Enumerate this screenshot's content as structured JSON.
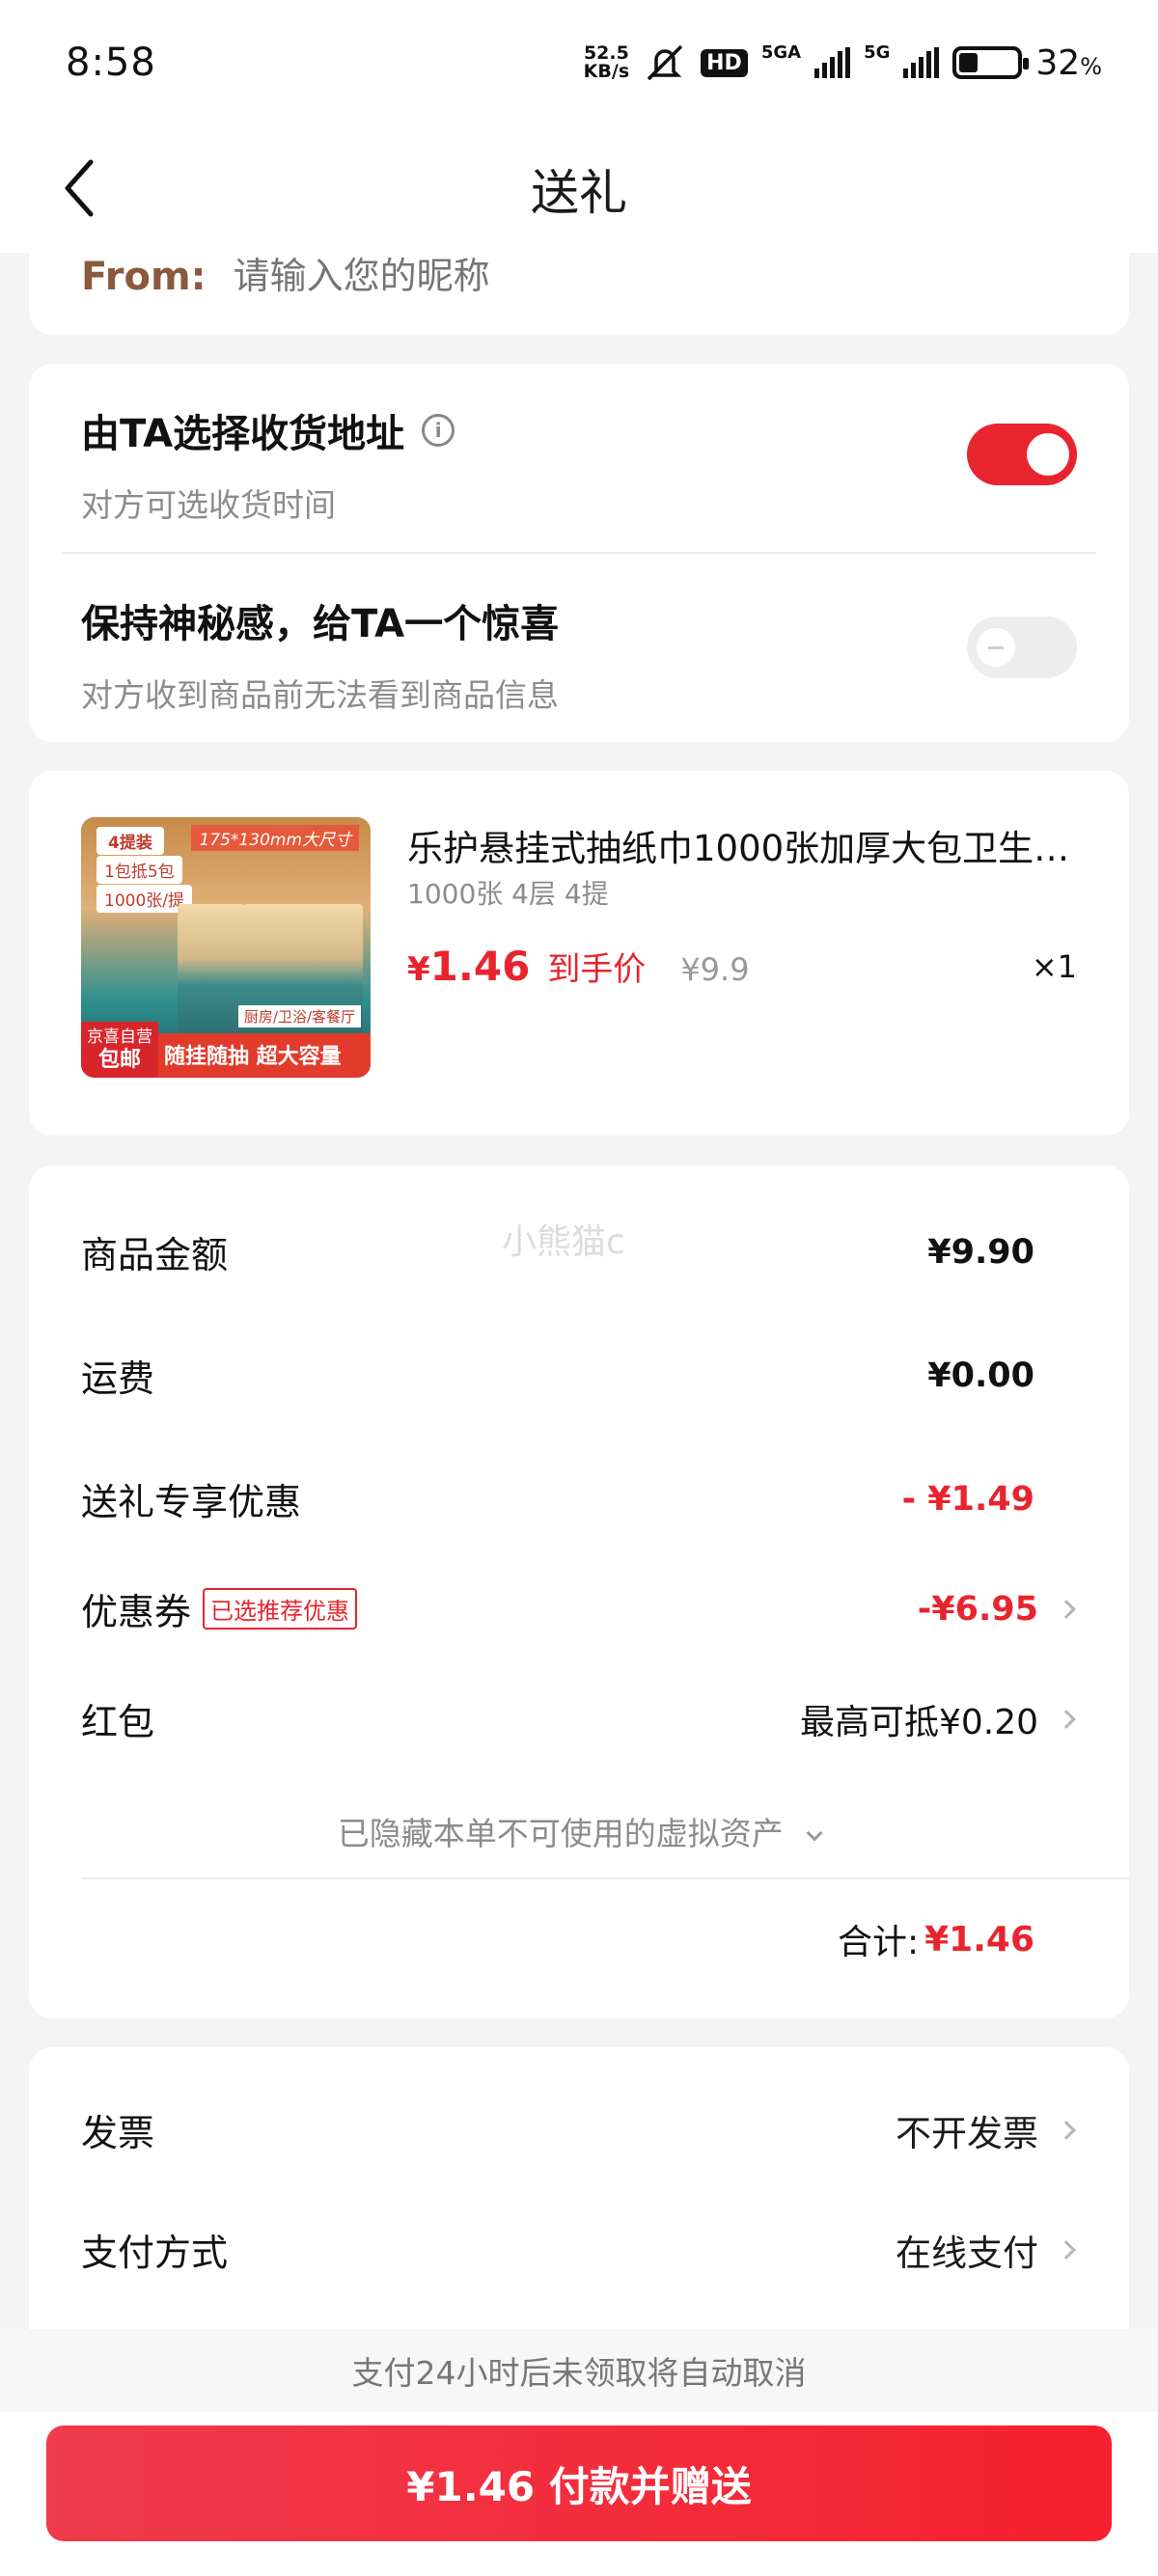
{
  "status_bar": {
    "time": "8:58",
    "net_speed_value": "52.5",
    "net_speed_unit": "KB/s",
    "hd_label": "HD",
    "sim1_label": "5GA",
    "sim2_label": "5G",
    "battery_pct": "32",
    "battery_pct_suffix": "%",
    "battery_level": 0.32
  },
  "header": {
    "title": "送礼"
  },
  "from": {
    "label": "From:",
    "placeholder": "请输入您的昵称"
  },
  "options": [
    {
      "title": "由TA选择收货地址",
      "subtitle": "对方可选收货时间",
      "enabled": true
    },
    {
      "title": "保持神秘感，给TA一个惊喜",
      "subtitle": "对方收到商品前无法看到商品信息",
      "enabled": false
    }
  ],
  "product": {
    "title": "乐护悬挂式抽纸巾1000张加厚大包卫生…",
    "spec": "1000张 4层 4提",
    "currency": "¥",
    "price": "1.46",
    "price_label": "到手价",
    "original_price": "¥9.9",
    "quantity": "×1",
    "thumb": {
      "tag_pack": "4提装",
      "tag_bundle": "1包抵5包",
      "tag_count": "1000张/提",
      "tag_size": "175*130mm大尺寸",
      "tag_rooms": "厨房/卫浴/客餐厅",
      "tag_shipping_1": "京喜自营",
      "tag_shipping_2": "包邮",
      "slogan": "随挂随抽 超大容量"
    }
  },
  "summary": {
    "watermark": "小熊猫c",
    "goods_amount_label": "商品金额",
    "goods_amount": "¥9.90",
    "shipping_label": "运费",
    "shipping": "¥0.00",
    "gift_discount_label": "送礼专享优惠",
    "gift_discount": "- ¥1.49",
    "coupon_label": "优惠券",
    "coupon_badge": "已选推荐优惠",
    "coupon_value": "-¥6.95",
    "redpacket_label": "红包",
    "redpacket_value": "最高可抵¥0.20",
    "hidden_assets": "已隐藏本单不可使用的虚拟资产",
    "total_label": "合计:",
    "total_value": "¥1.46"
  },
  "invoice": {
    "invoice_label": "发票",
    "invoice_value": "不开发票",
    "payment_label": "支付方式",
    "payment_value": "在线支付"
  },
  "bottom": {
    "notice": "支付24小时后未领取将自动取消",
    "pay_button": "¥1.46 付款并赠送"
  },
  "colors": {
    "accent": "#e8242e",
    "brown_label": "#8a5a3c"
  }
}
